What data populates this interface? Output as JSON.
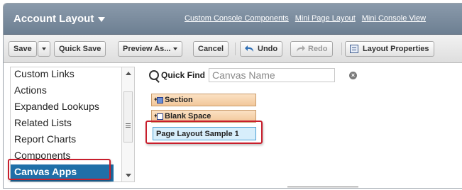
{
  "header": {
    "title": "Account Layout",
    "links": [
      "Custom Console Components",
      "Mini Page Layout",
      "Mini Console View"
    ]
  },
  "toolbar": {
    "save": "Save",
    "quick_save": "Quick Save",
    "preview_as": "Preview As...",
    "cancel": "Cancel",
    "undo": "Undo",
    "redo": "Redo",
    "layout_properties": "Layout Properties"
  },
  "categories": {
    "items": [
      "Custom Links",
      "Actions",
      "Expanded Lookups",
      "Related Lists",
      "Report Charts",
      "Components",
      "Canvas Apps"
    ],
    "selected": "Canvas Apps"
  },
  "quick_find": {
    "label": "Quick Find",
    "placeholder": "Canvas Name",
    "clear": "×"
  },
  "palette": {
    "items": [
      "Section",
      "Blank Space",
      "Page Layout Sample 1"
    ]
  },
  "colors": {
    "header": "#6d7f92",
    "selected_item": "#1f6fa8",
    "highlight": "#c81e2c",
    "palette_item": "#f2c79a",
    "canvas_item": "#d7eefb"
  }
}
